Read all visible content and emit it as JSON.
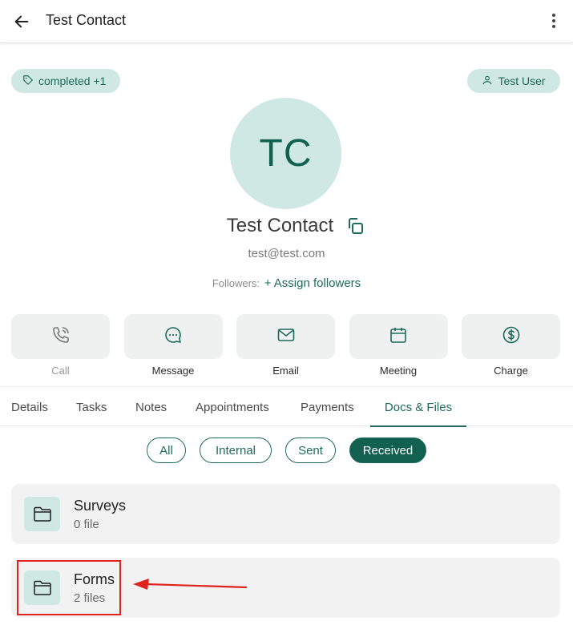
{
  "header": {
    "title": "Test Contact"
  },
  "chips": {
    "tag": "completed +1",
    "user": "Test User"
  },
  "contact": {
    "initials": "TC",
    "name": "Test Contact",
    "email": "test@test.com",
    "followers_label": "Followers:",
    "assign_followers": "+ Assign followers"
  },
  "actions": [
    {
      "label": "Call",
      "icon": "phone-icon",
      "enabled": false
    },
    {
      "label": "Message",
      "icon": "message-icon",
      "enabled": true
    },
    {
      "label": "Email",
      "icon": "email-icon",
      "enabled": true
    },
    {
      "label": "Meeting",
      "icon": "calendar-icon",
      "enabled": true
    },
    {
      "label": "Charge",
      "icon": "dollar-icon",
      "enabled": true
    }
  ],
  "tabs": [
    {
      "label": "Details",
      "active": false
    },
    {
      "label": "Tasks",
      "active": false
    },
    {
      "label": "Notes",
      "active": false
    },
    {
      "label": "Appointments",
      "active": false
    },
    {
      "label": "Payments",
      "active": false
    },
    {
      "label": "Docs & Files",
      "active": true
    }
  ],
  "filters": [
    {
      "label": "All",
      "active": false
    },
    {
      "label": "Internal",
      "active": false
    },
    {
      "label": "Sent",
      "active": false
    },
    {
      "label": "Received",
      "active": true
    }
  ],
  "folders": [
    {
      "name": "Surveys",
      "count": "0 file"
    },
    {
      "name": "Forms",
      "count": "2 files"
    }
  ],
  "colors": {
    "accent": "#12604f",
    "chip_bg": "#cfe8e3",
    "annotation": "#e0231f"
  }
}
